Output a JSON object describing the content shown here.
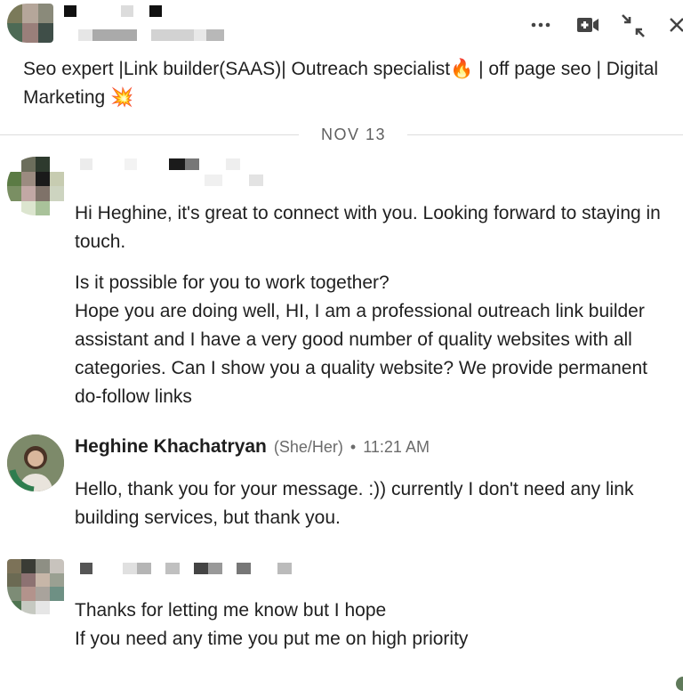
{
  "header": {
    "more_icon": "ellipsis-icon",
    "video_icon": "video-call-icon",
    "minimize_icon": "collapse-arrows-icon",
    "close_icon": "close-icon"
  },
  "profile_headline": "Seo expert |Link builder(SAAS)| Outreach specialist🔥 | off page seo | Digital Marketing 💥",
  "date_divider": "NOV 13",
  "messages": [
    {
      "sender": "",
      "paragraphs": [
        "Hi Heghine, it's great to connect with you. Looking forward to staying in touch.",
        "Is it possible for you to work together?",
        "Hope you are doing well, HI, I am a professional outreach link builder assistant and I have a very good number of quality websites with all categories. Can I show you a quality website? We provide permanent do-follow links"
      ]
    },
    {
      "sender": "Heghine Khachatryan",
      "pronouns": "(She/Her)",
      "separator": "•",
      "time": "11:21 AM",
      "paragraphs": [
        "Hello, thank you for your message. :)) currently I don't need any link building services, but thank you."
      ]
    },
    {
      "sender": "",
      "paragraphs": [
        "Thanks for letting me know but I hope",
        "If you need any time you put me on high priority"
      ]
    }
  ]
}
